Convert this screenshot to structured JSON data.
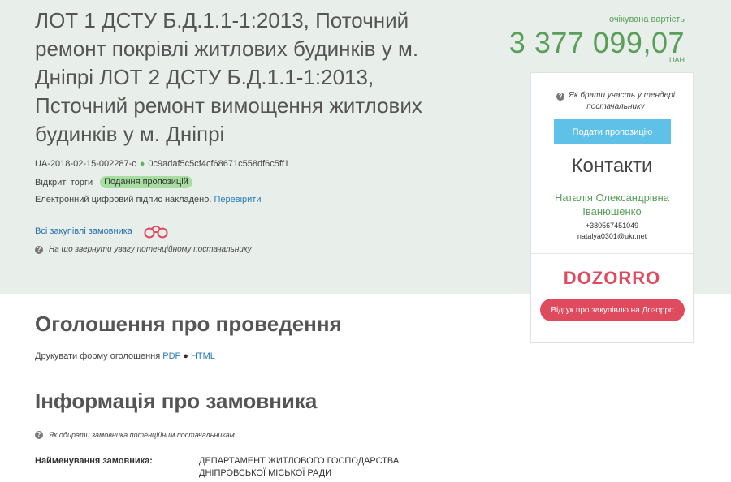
{
  "tender": {
    "title": "ЛОТ 1 ДСТУ Б.Д.1.1-1:2013, Поточний ремонт покрівлі житлових будинків у м. Дніпрі ЛОТ 2 ДСТУ Б.Д.1.1-1:2013, Псточний ремонт вимощення житлових будинків у м. Дніпрі",
    "id": "UA-2018-02-15-002287-c",
    "hash": "0c9adaf5c5cf4cf68671c558df6c5ff1",
    "procedure": "Відкриті торги",
    "status": "Подання пропозицій",
    "signature_text": "Електронний цифровий підпис накладено.",
    "signature_link": "Перевірити",
    "all_purchases_link": "Всі закупівлі замовника",
    "attention_hint": "На що звернути увагу потенційному постачальнику"
  },
  "price": {
    "label": "очікувана вартість",
    "value": "3 377 099,07",
    "currency": "UAH"
  },
  "sidebar": {
    "participate_hint": "Як брати участь у тендері постачальнику",
    "submit_button": "Подати пропозицію",
    "contacts_title": "Контакти",
    "contact_name": "Наталія Олександрівна Іванюшенко",
    "contact_phone": "+380567451049",
    "contact_email": "natalya0301@ukr.net",
    "dozorro_logo": "DOZORRO",
    "dozorro_button": "Відгук про закупівлю на Дозорро"
  },
  "announcement": {
    "title": "Оголошення про проведення",
    "print_label": "Друкувати форму оголошення",
    "pdf_link": "PDF",
    "html_link": "HTML"
  },
  "customer": {
    "title": "Інформація про замовника",
    "hint": "Як обирати замовника потенційним постачальникам",
    "name_label": "Найменування замовника:",
    "name_value": "ДЕПАРТАМЕНТ ЖИТЛОВОГО ГОСПОДАРСТВА ДНІПРОВСЬКОЇ МІСЬКОЇ РАДИ"
  },
  "colors": {
    "accent_green": "#5a9e5a",
    "link_blue": "#2a7bb8",
    "button_blue": "#5fc0e8",
    "dozorro_red": "#e04a5f",
    "band_bg": "#e8efea"
  },
  "icons": [
    "question-icon",
    "binoculars-icon"
  ]
}
